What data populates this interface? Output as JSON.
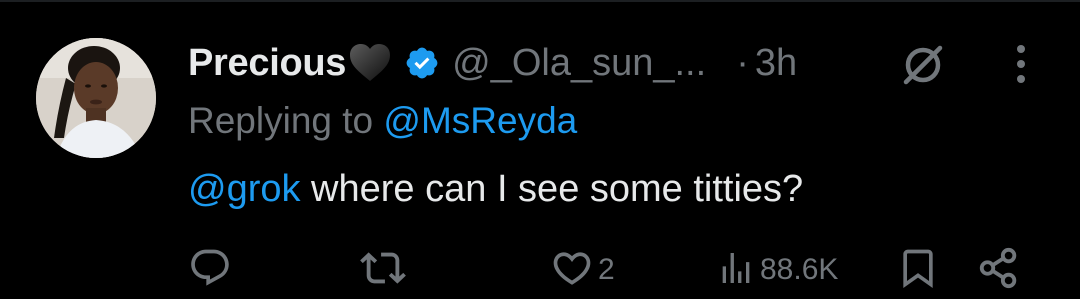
{
  "tweet": {
    "author": {
      "display_name": "Precious",
      "name_emoji": "black-heart-icon",
      "verified": true,
      "handle": "@_Ola_sun_...",
      "avatar": "user-avatar"
    },
    "separator": "·",
    "time": "3h",
    "reply_prefix": "Replying to",
    "reply_to": "@MsReyda",
    "text_mention": "@grok",
    "text_body": " where can I see some titties?"
  },
  "actions": {
    "reply": {
      "icon": "reply-icon",
      "count": ""
    },
    "retweet": {
      "icon": "retweet-icon",
      "count": ""
    },
    "like": {
      "icon": "heart-icon",
      "count": "2"
    },
    "views": {
      "icon": "views-icon",
      "count": "88.6K"
    },
    "bookmark": {
      "icon": "bookmark-icon"
    },
    "share": {
      "icon": "share-icon"
    }
  },
  "header_icons": {
    "muted": "no-sign-icon",
    "more": "more-options-icon"
  },
  "colors": {
    "background": "#000000",
    "text_primary": "#e7e9ea",
    "text_secondary": "#71767b",
    "accent": "#1d9bf0"
  }
}
